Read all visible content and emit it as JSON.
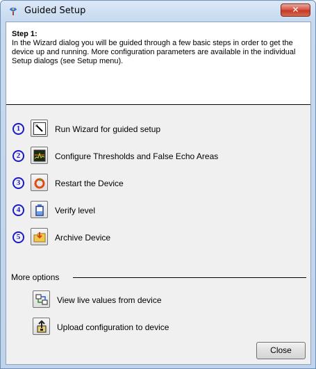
{
  "window": {
    "title": "Guided Setup",
    "close_glyph": "✕"
  },
  "info": {
    "heading": "Step 1:",
    "body": "In the Wizard dialog you will be guided through a few basic steps in order to get the device up and running. More configuration parameters are available in the individual Setup dialogs (see Setup menu)."
  },
  "steps": [
    {
      "num": "1",
      "label": "Run Wizard for guided setup",
      "icon": "wizard-wand-icon"
    },
    {
      "num": "2",
      "label": "Configure Thresholds and False Echo Areas",
      "icon": "echo-chart-icon"
    },
    {
      "num": "3",
      "label": "Restart the Device",
      "icon": "restart-icon"
    },
    {
      "num": "4",
      "label": "Verify level",
      "icon": "level-tank-icon"
    },
    {
      "num": "5",
      "label": "Archive Device",
      "icon": "archive-folder-icon"
    }
  ],
  "more": {
    "label": "More options",
    "options": [
      {
        "label": "View live values from device",
        "icon": "live-values-icon"
      },
      {
        "label": "Upload configuration to device",
        "icon": "upload-icon"
      }
    ]
  },
  "close_button": "Close"
}
